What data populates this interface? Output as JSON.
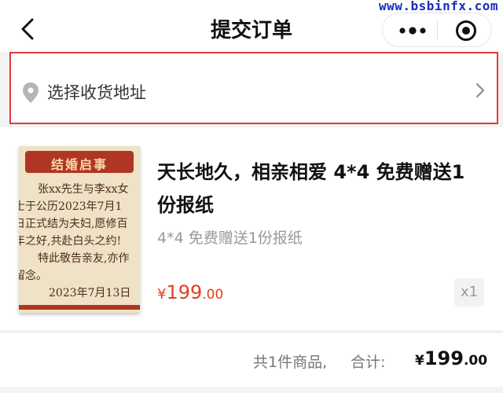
{
  "header": {
    "title": "提交订单",
    "watermark": "www.bsbinfx.com",
    "back_icon": "chevron-left-icon",
    "more_icon": "more-dots-icon",
    "close_icon": "target-icon"
  },
  "address": {
    "placeholder": "选择收货地址",
    "icon": "location-pin-icon",
    "chevron": "chevron-right-icon",
    "highlight_color": "#e03c3c"
  },
  "product": {
    "name": "天长地久，相亲相爱 4*4 免费赠送1份报纸",
    "spec": "4*4 免费赠送1份报纸",
    "price_symbol": "¥",
    "price_int": "199",
    "price_dec": ".00",
    "quantity": "x1",
    "price_color": "#e0411f",
    "image": {
      "banner": "结婚启事",
      "lines": [
        "张xx先生与李xx女",
        "士于公历2023年7月1",
        "日正式结为夫妇,愿修百",
        "年之好,共赴白头之约!",
        "特此敬告亲友,亦作",
        "留念。",
        "2023年7月13日"
      ]
    }
  },
  "summary": {
    "count_text": "共1件商品,",
    "total_label": "合计:",
    "price_symbol": "¥",
    "price_int": "199",
    "price_dec": ".00"
  }
}
